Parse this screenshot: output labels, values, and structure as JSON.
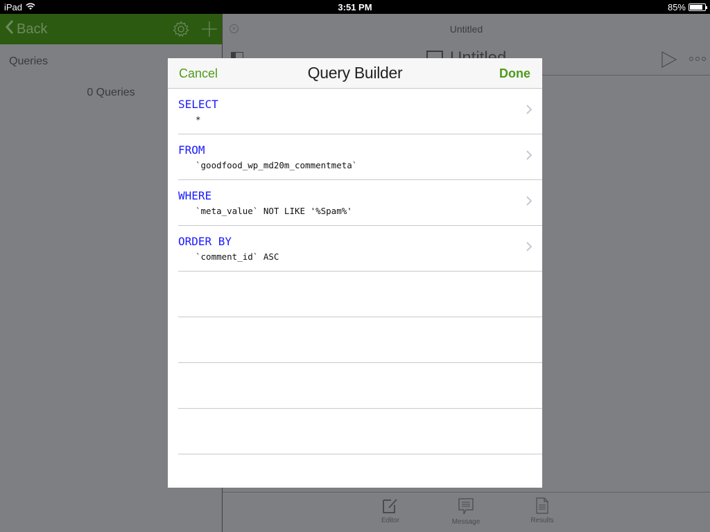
{
  "status_bar": {
    "device": "iPad",
    "time": "3:51 PM",
    "battery_text": "85%",
    "battery_level": 0.85
  },
  "left_pane": {
    "back_label": "Back",
    "section_label": "Queries",
    "count_label": "0 Queries"
  },
  "right_pane": {
    "tab_title": "Untitled",
    "doc_title": "Untitled",
    "tabs": [
      {
        "label": "Editor",
        "icon": "edit-icon"
      },
      {
        "label": "Message",
        "icon": "message-icon"
      },
      {
        "label": "Results",
        "icon": "document-icon"
      }
    ]
  },
  "modal": {
    "title": "Query Builder",
    "cancel_label": "Cancel",
    "done_label": "Done",
    "rows": [
      {
        "keyword": "SELECT",
        "value": "*"
      },
      {
        "keyword": "FROM",
        "value": "`goodfood_wp_md20m_commentmeta`"
      },
      {
        "keyword": "WHERE",
        "value": "`meta_value` NOT LIKE '%Spam%'"
      },
      {
        "keyword": "ORDER BY",
        "value": "`comment_id` ASC"
      }
    ],
    "empty_rows": 5
  },
  "colors": {
    "accent_green": "#4e9a1c",
    "nav_green": "#2c5a11",
    "keyword_blue": "#1a1aff"
  }
}
